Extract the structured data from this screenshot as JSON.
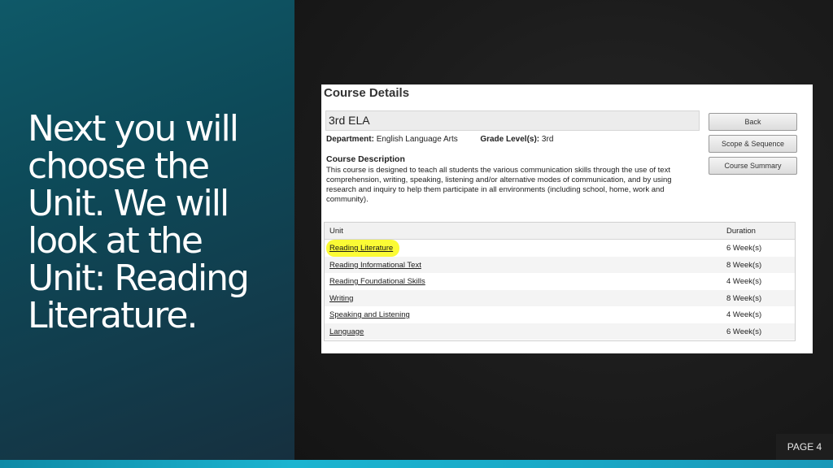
{
  "slide": {
    "heading": "Next you will\nchoose the\nUnit. We will\nlook at the\nUnit: Reading\nLiterature.",
    "page_label": "PAGE 4"
  },
  "course": {
    "section_title": "Course Details",
    "name": "3rd ELA",
    "department_label": "Department:",
    "department_value": "English Language Arts",
    "grade_label": "Grade Level(s):",
    "grade_value": "3rd",
    "description_heading": "Course Description",
    "description": "This course is designed to teach all students the various communication skills through the use of text comprehension, writing, speaking, listening and/or alternative modes of communication, and by using research and inquiry to help them participate in all environments (including school, home, work and community)."
  },
  "buttons": {
    "back": "Back",
    "scope": "Scope & Sequence",
    "summary": "Course Summary"
  },
  "table": {
    "headers": {
      "unit": "Unit",
      "duration": "Duration"
    },
    "rows": [
      {
        "unit": "Reading Literature",
        "duration": "6 Week(s)"
      },
      {
        "unit": "Reading Informational Text",
        "duration": "8 Week(s)"
      },
      {
        "unit": "Reading Foundational Skills",
        "duration": "4 Week(s)"
      },
      {
        "unit": "Writing",
        "duration": "8 Week(s)"
      },
      {
        "unit": "Speaking and Listening",
        "duration": "4 Week(s)"
      },
      {
        "unit": "Language",
        "duration": "6 Week(s)"
      }
    ]
  },
  "colors": {
    "highlight": "#fbfb2a",
    "panel_teal": "#0d4a59",
    "accent_bar": "#1cb4d0"
  }
}
